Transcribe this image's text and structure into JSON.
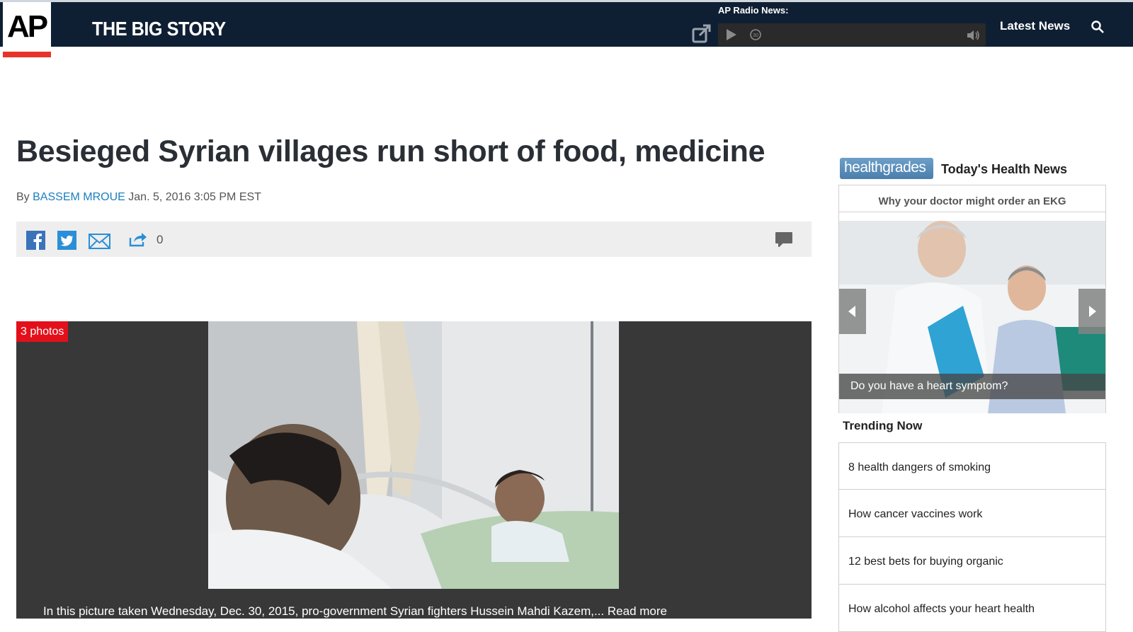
{
  "header": {
    "logo_text": "AP",
    "site_title": "THE BIG STORY",
    "radio_label": "AP Radio News:",
    "nav_latest": "Latest News"
  },
  "article": {
    "headline": "Besieged Syrian villages run short of food, medicine",
    "byline_prefix": "By",
    "author": "BASSEM MROUE",
    "date": "Jan. 5, 2016 3:05 PM EST",
    "share_count": "0",
    "photo_badge": "3 photos",
    "photo_caption": "In this picture taken Wednesday, Dec. 30, 2015, pro-government Syrian fighters Hussein Mahdi Kazem,... Read more"
  },
  "sidebar": {
    "healthgrades_logo": "healthgrades",
    "health_title": "Today's Health News",
    "box_heading": "Why your doctor might order an EKG",
    "image_caption": "Do you have a heart symptom?",
    "trending_title": "Trending Now",
    "trending_items": [
      {
        "label": "8 health dangers of smoking"
      },
      {
        "label": "How cancer vaccines work"
      },
      {
        "label": "12 best bets for buying organic"
      },
      {
        "label": "How alcohol affects your heart health"
      }
    ]
  },
  "colors": {
    "header_bg": "#0f1f33",
    "accent_red": "#e8332a",
    "author_link": "#1a7fbf",
    "photo_bg": "#383838"
  },
  "icons": [
    "popout-icon",
    "play-icon",
    "rewind-icon",
    "volume-icon",
    "search-icon",
    "facebook-icon",
    "twitter-icon",
    "email-icon",
    "share-icon",
    "comment-icon",
    "arrow-left-icon",
    "arrow-right-icon"
  ]
}
